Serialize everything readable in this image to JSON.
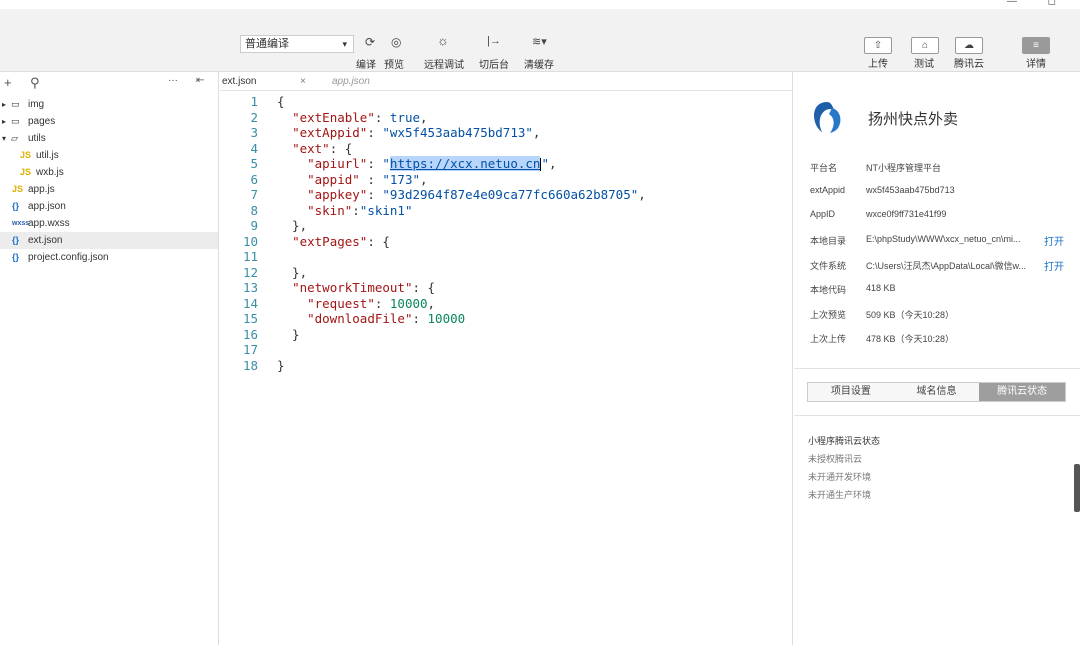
{
  "toolbar": {
    "compile_mode": "普通编译",
    "labels": [
      "编译",
      "预览",
      "远程调试",
      "切后台",
      "清缓存"
    ],
    "right_labels": [
      "上传",
      "测试",
      "腾讯云",
      "详情"
    ]
  },
  "sidebar": {
    "items": [
      {
        "label": "img",
        "type": "folder"
      },
      {
        "label": "pages",
        "type": "folder"
      },
      {
        "label": "utils",
        "type": "folder-open"
      },
      {
        "label": "util.js",
        "type": "js"
      },
      {
        "label": "wxb.js",
        "type": "js"
      },
      {
        "label": "app.js",
        "type": "js"
      },
      {
        "label": "app.json",
        "type": "json"
      },
      {
        "label": "app.wxss",
        "type": "wxss"
      },
      {
        "label": "ext.json",
        "type": "json"
      },
      {
        "label": "project.config.json",
        "type": "json"
      }
    ]
  },
  "editor": {
    "tabs": [
      {
        "label": "ext.json",
        "active": true
      },
      {
        "label": "app.json",
        "active": false
      }
    ],
    "line_numbers": [
      "1",
      "2",
      "3",
      "4",
      "5",
      "6",
      "7",
      "8",
      "9",
      "10",
      "11",
      "12",
      "13",
      "14",
      "15",
      "16",
      "17",
      "18"
    ]
  },
  "code": {
    "ext_enable_key": "\"extEnable\"",
    "ext_enable_val": "true",
    "ext_appid_key": "\"extAppid\"",
    "ext_appid_val": "\"wx5f453aab475bd713\"",
    "ext_key": "\"ext\"",
    "apiurl_key": "\"apiurl\"",
    "apiurl_val": "https://xcx.netuo.cn",
    "appid_key": "\"appid\"",
    "appid_val": "\"173\"",
    "appkey_key": "\"appkey\"",
    "appkey_val": "\"93d2964f87e4e09ca77fc660a62b8705\"",
    "skin_key": "\"skin\"",
    "skin_val": "\"skin1\"",
    "ext_pages_key": "\"extPages\"",
    "network_key": "\"networkTimeout\"",
    "request_key": "\"request\"",
    "request_val": "10000",
    "download_key": "\"downloadFile\"",
    "download_val": "10000"
  },
  "panel": {
    "app_name": "扬州快点外卖",
    "info": [
      {
        "key": "平台名",
        "value": "NT小程序管理平台"
      },
      {
        "key": "extAppid",
        "value": "wx5f453aab475bd713"
      },
      {
        "key": "AppID",
        "value": "wxce0f9ff731e41f99"
      },
      {
        "key": "本地目录",
        "value": "E:\\phpStudy\\WWW\\xcx_netuo_cn\\mi...",
        "link": "打开"
      },
      {
        "key": "文件系统",
        "value": "C:\\Users\\汪凤杰\\AppData\\Local\\微信w...",
        "link": "打开"
      },
      {
        "key": "本地代码",
        "value": "418 KB"
      },
      {
        "key": "上次预览",
        "value": "509 KB（今天10:28）"
      },
      {
        "key": "上次上传",
        "value": "478 KB（今天10:28）"
      }
    ],
    "tabs": [
      "项目设置",
      "域名信息",
      "腾讯云状态"
    ],
    "status_title": "小程序腾讯云状态",
    "status_lines": [
      "未授权腾讯云",
      "未开通开发环境",
      "未开通生产环境"
    ]
  }
}
